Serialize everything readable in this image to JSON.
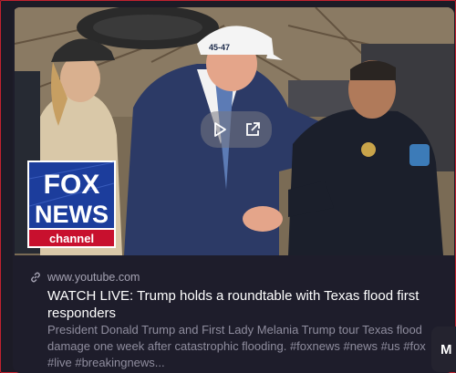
{
  "thumbnail": {
    "overlay": {
      "play_icon": "play-icon",
      "open_icon": "open-external-icon"
    },
    "hat_text": "45-47",
    "logo": {
      "line1": "FOX",
      "line2": "NEWS",
      "line3": "channel"
    }
  },
  "card": {
    "source": "www.youtube.com",
    "title": "WATCH LIVE: Trump holds a roundtable with Texas flood first responders",
    "description": "President Donald Trump and First Lady Melania Trump tour Texas flood damage one week after catastrophic flooding. #foxnews #news #us #fox #live #breakingnews..."
  },
  "side_chip": {
    "letter": "M"
  },
  "colors": {
    "border": "#c1222f",
    "card_bg": "#1e1d2b",
    "fox_blue": "#1c3d9c",
    "fox_red": "#c8102e"
  }
}
